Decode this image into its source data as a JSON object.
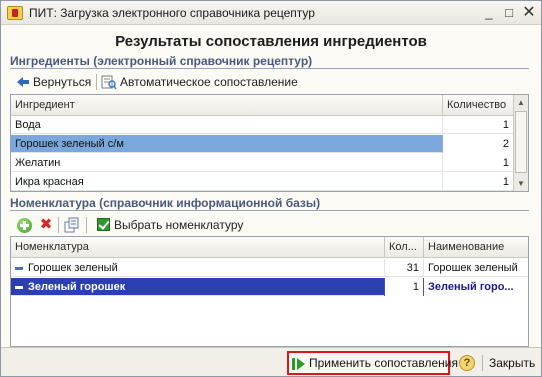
{
  "window": {
    "title": "ПИТ: Загрузка электронного справочника рецептур",
    "min_glyph": "_",
    "max_glyph": "□",
    "close_glyph": "✕"
  },
  "form": {
    "title": "Результаты сопоставления ингредиентов"
  },
  "ingredients": {
    "header": "Ингредиенты (электронный справочник рецептур)",
    "toolbar": {
      "back_label": "Вернуться",
      "auto_label": "Автоматическое сопоставление"
    },
    "columns": {
      "name": "Ингредиент",
      "qty": "Количество"
    },
    "rows": [
      {
        "name": "Вода",
        "qty": "1"
      },
      {
        "name": "Горошек зеленый с/м",
        "qty": "2"
      },
      {
        "name": "Желатин",
        "qty": "1"
      },
      {
        "name": "Икра красная",
        "qty": "1"
      }
    ],
    "scroll_up_glyph": "▲",
    "scroll_down_glyph": "▼"
  },
  "nomenclature": {
    "header": "Номенклатура (справочник информационной базы)",
    "toolbar": {
      "select_label": "Выбрать номенклатуру",
      "delete_glyph": "✖"
    },
    "columns": {
      "name": "Номенклатура",
      "count": "Кол...",
      "title": "Наименование"
    },
    "rows": [
      {
        "name": "Горошек зеленый",
        "count": "31",
        "title": "Горошек зеленый"
      },
      {
        "name": "Зеленый горошек",
        "count": "1",
        "title": "Зеленый горо..."
      }
    ]
  },
  "footer": {
    "apply_label": "Применить сопоставления",
    "help_glyph": "?",
    "close_label": "Закрыть"
  },
  "colors": {
    "selection": "#7aa7dc",
    "current_row": "#2b3fb3",
    "section_header": "#4a5a7c",
    "apply_highlight": "#e1131b"
  }
}
